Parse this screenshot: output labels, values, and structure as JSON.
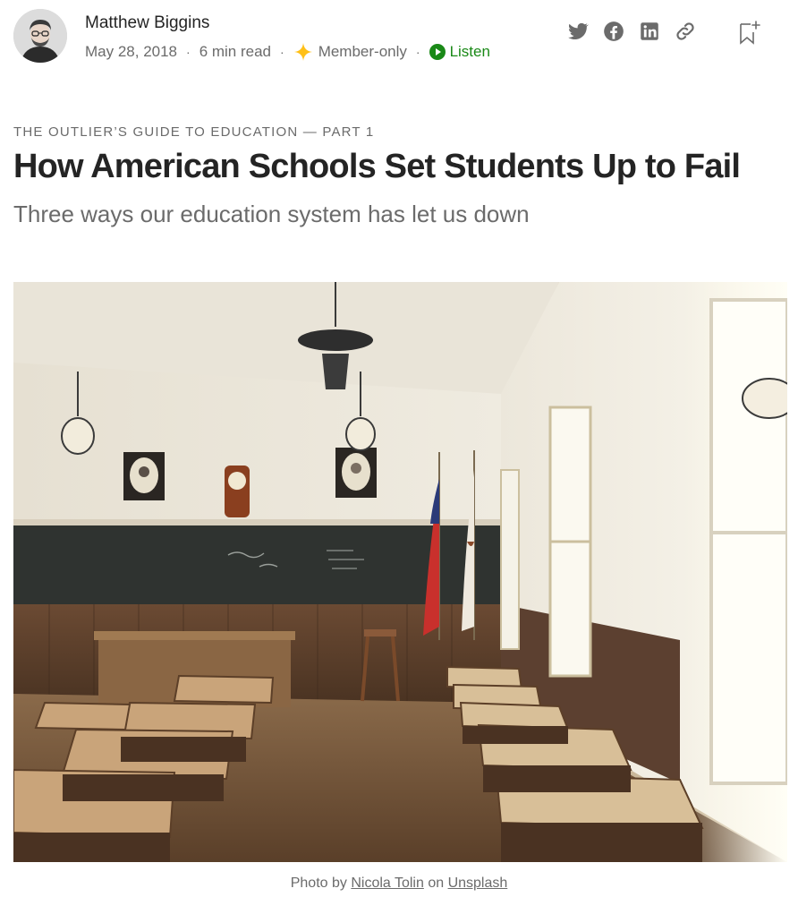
{
  "author": {
    "name": "Matthew Biggins"
  },
  "meta": {
    "date": "May 28, 2018",
    "read_time": "6 min read",
    "separator": "·",
    "member_label": "Member-only",
    "listen_label": "Listen",
    "listen_color": "#1a8917",
    "star_color": "#ffc017"
  },
  "share": {
    "icons": [
      "twitter-icon",
      "facebook-icon",
      "linkedin-icon",
      "link-icon",
      "bookmark-icon"
    ]
  },
  "article": {
    "kicker": "THE OUTLIER’S GUIDE TO EDUCATION — PART 1",
    "title": "How American Schools Set Students Up to Fail",
    "subtitle": "Three ways our education system has let us down"
  },
  "caption": {
    "prefix": "Photo by",
    "photographer": "Nicola Tolin",
    "middle": "on",
    "source": "Unsplash"
  }
}
